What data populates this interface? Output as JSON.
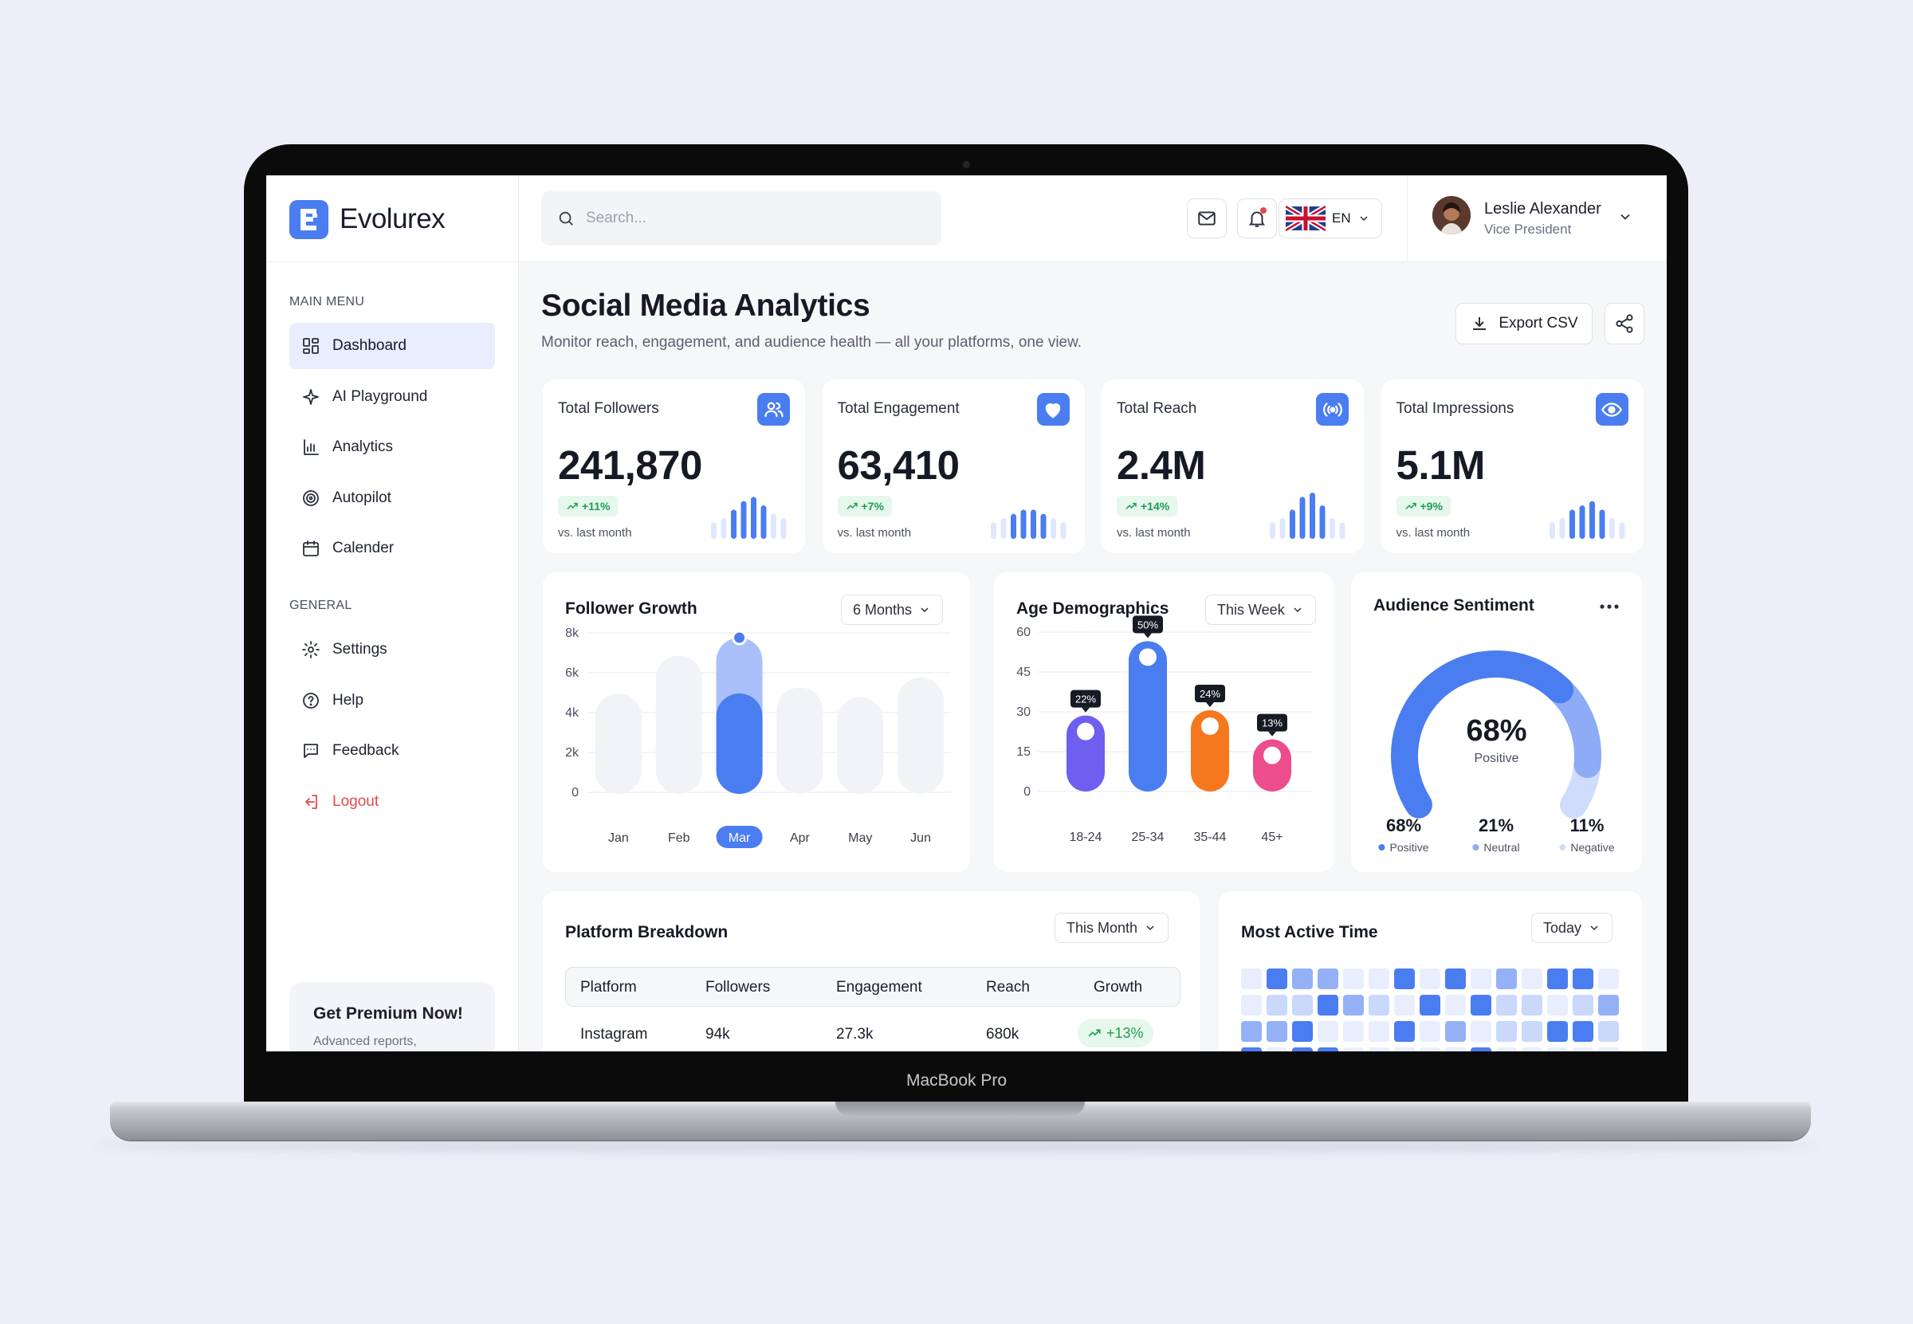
{
  "brand": {
    "name": "Evolurex",
    "device_label": "MacBook Pro"
  },
  "sidebar": {
    "main_menu_title": "MAIN MENU",
    "main_items": [
      {
        "label": "Dashboard",
        "icon": "grid-icon",
        "active": true
      },
      {
        "label": "AI Playground",
        "icon": "sparkle-icon"
      },
      {
        "label": "Analytics",
        "icon": "chart-icon"
      },
      {
        "label": "Autopilot",
        "icon": "target-icon"
      },
      {
        "label": "Calender",
        "icon": "calendar-icon"
      }
    ],
    "general_title": "GENERAL",
    "general_items": [
      {
        "label": "Settings",
        "icon": "gear-icon"
      },
      {
        "label": "Help",
        "icon": "help-icon"
      },
      {
        "label": "Feedback",
        "icon": "message-icon"
      },
      {
        "label": "Logout",
        "icon": "logout-icon",
        "color": "#e5484d"
      }
    ],
    "premium": {
      "title": "Get Premium Now!",
      "subtitle": "Advanced reports,"
    }
  },
  "topbar": {
    "search_placeholder": "Search...",
    "language": "EN",
    "user": {
      "name": "Leslie Alexander",
      "role": "Vice President"
    }
  },
  "header": {
    "title": "Social Media Analytics",
    "subtitle": "Monitor reach, engagement, and audience health — all your platforms, one view.",
    "export_label": "Export CSV"
  },
  "kpis": [
    {
      "title": "Total Followers",
      "value": "241,870",
      "change": "+11%",
      "foot": "vs. last month",
      "icon": "users-icon"
    },
    {
      "title": "Total Engagement",
      "value": "63,410",
      "change": "+7%",
      "foot": "vs. last month",
      "icon": "heart-icon"
    },
    {
      "title": "Total Reach",
      "value": "2.4M",
      "change": "+14%",
      "foot": "vs. last month",
      "icon": "broadcast-icon"
    },
    {
      "title": "Total Impressions",
      "value": "5.1M",
      "change": "+9%",
      "foot": "vs. last month",
      "icon": "eye-icon"
    }
  ],
  "follower_growth": {
    "title": "Follower Growth",
    "filter": "6 Months",
    "selected": "Mar"
  },
  "age_demographics": {
    "title": "Age Demographics",
    "filter": "This Week"
  },
  "audience_sentiment": {
    "title": "Audience Sentiment",
    "center_value": "68%",
    "center_label": "Positive",
    "items": [
      {
        "value": "68%",
        "label": "Positive",
        "color": "#4a7df0"
      },
      {
        "value": "21%",
        "label": "Neutral",
        "color": "#8eabf5"
      },
      {
        "value": "11%",
        "label": "Negative",
        "color": "#cfdcfb"
      }
    ]
  },
  "platform_breakdown": {
    "title": "Platform Breakdown",
    "filter": "This Month",
    "columns": [
      "Platform",
      "Followers",
      "Engagement",
      "Reach",
      "Growth"
    ],
    "rows": [
      [
        "Instagram",
        "94k",
        "27.3k",
        "680k",
        "+13%"
      ]
    ]
  },
  "most_active_time": {
    "title": "Most Active Time",
    "filter": "Today",
    "levels": [
      [
        1,
        4,
        3,
        3,
        1,
        1,
        4,
        1,
        4,
        1,
        3,
        1,
        4,
        4,
        1
      ],
      [
        1,
        2,
        2,
        4,
        3,
        2,
        1,
        4,
        1,
        4,
        2,
        2,
        1,
        2,
        3
      ],
      [
        3,
        3,
        4,
        1,
        1,
        1,
        4,
        1,
        3,
        1,
        2,
        2,
        4,
        4,
        2
      ],
      [
        4,
        1,
        4,
        4,
        1,
        1,
        1,
        1,
        1,
        4,
        1,
        1,
        1,
        1,
        1
      ]
    ]
  },
  "chart_data": [
    {
      "type": "bar",
      "title": "Follower Growth",
      "categories": [
        "Jan",
        "Feb",
        "Mar",
        "Apr",
        "May",
        "Jun"
      ],
      "values": [
        5.2,
        7.1,
        8.0,
        5.5,
        5.0,
        6.0
      ],
      "y_ticks": [
        "0",
        "2k",
        "4k",
        "6k",
        "8k"
      ],
      "ylim": [
        0,
        8
      ]
    },
    {
      "type": "bar",
      "title": "Age Demographics",
      "categories": [
        "18-24",
        "25-34",
        "35-44",
        "45+"
      ],
      "values": [
        22,
        50,
        24,
        13
      ],
      "labels": [
        "22%",
        "50%",
        "24%",
        "13%"
      ],
      "colors": [
        "#6e5ff0",
        "#4a7df0",
        "#f5781f",
        "#ec4d8c"
      ],
      "y_ticks": [
        "0",
        "15",
        "30",
        "45",
        "60"
      ],
      "ylim": [
        0,
        60
      ]
    },
    {
      "type": "pie",
      "title": "Audience Sentiment",
      "categories": [
        "Positive",
        "Neutral",
        "Negative"
      ],
      "values": [
        68,
        21,
        11
      ]
    },
    {
      "type": "bar",
      "title": "KPI sparklines",
      "series": [
        {
          "values": [
            2,
            3,
            5,
            7,
            8,
            6,
            4,
            3
          ]
        },
        {
          "values": [
            2,
            3,
            4,
            5,
            5,
            4,
            3,
            2
          ]
        },
        {
          "values": [
            2,
            3,
            5,
            8,
            9,
            6,
            3,
            2
          ]
        },
        {
          "values": [
            2,
            3,
            5,
            6,
            7,
            5,
            3,
            2
          ]
        }
      ]
    }
  ]
}
